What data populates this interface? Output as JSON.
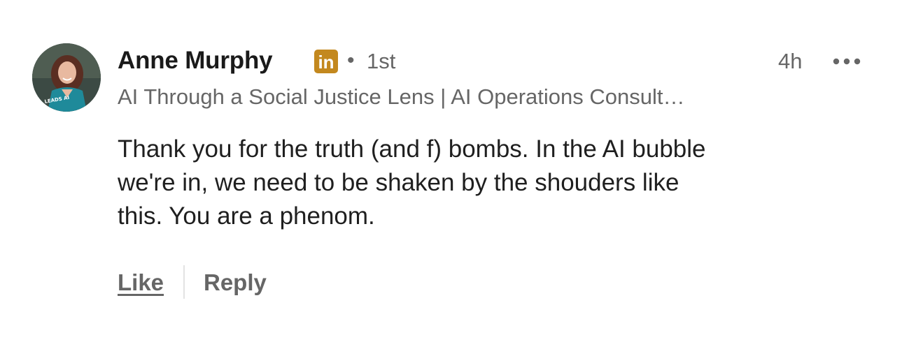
{
  "comment": {
    "author": {
      "name": "Anne Murphy",
      "badge_icon": "linkedin-premium-icon",
      "badge_text": "in",
      "badge_color": "#c3881e",
      "separator": "•",
      "connection_degree": "1st",
      "headline": "AI Through a Social Justice Lens | AI Operations Consult…",
      "avatar_ring_text": "LEADS AI"
    },
    "timestamp": "4h",
    "more_icon": "more-options-icon",
    "body_lines": [
      "Thank you for the truth (and f) bombs. In the AI bubble",
      "we're in, we need to be shaken by the shouders like",
      "this. You are a phenom."
    ],
    "actions": {
      "like_label": "Like",
      "reply_label": "Reply"
    }
  },
  "colors": {
    "text_primary": "#1f1f1f",
    "text_secondary": "#666666",
    "avatar_ring": "#7a3f8f",
    "divider": "#e3e3e3"
  }
}
